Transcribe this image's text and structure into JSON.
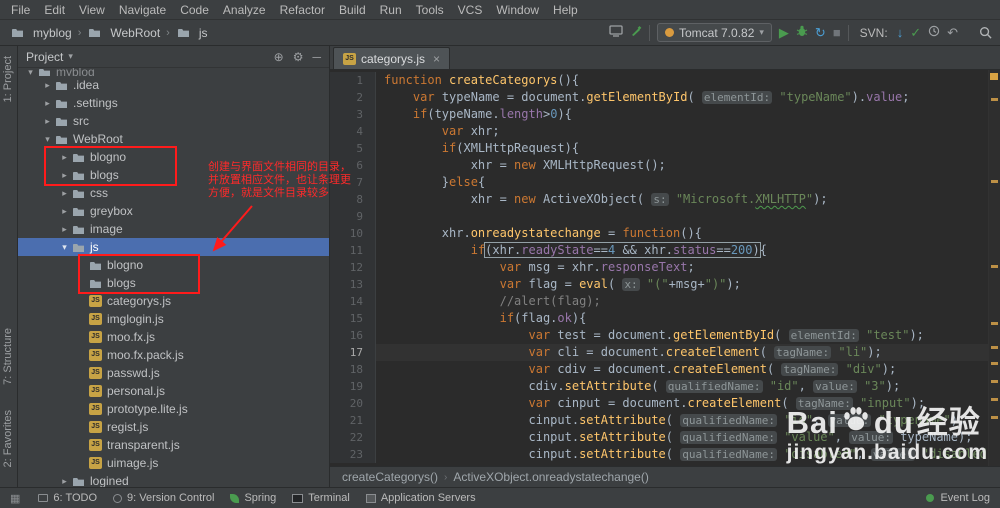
{
  "icons": {
    "chevron": "›",
    "expanded": "▾",
    "collapsed": "▸",
    "gear": "⚙",
    "target": "⊕",
    "hide": "─",
    "play": "▶",
    "stop": "■",
    "refresh": "↻",
    "check": "✓",
    "undo": "↶",
    "arrow_down": "↓",
    "caret_down": "▾",
    "close": "×",
    "corner": "▦"
  },
  "colors": {
    "selection_blue": "#4b6eaf",
    "annotation_red": "#ff1b1b",
    "keyword_orange": "#cc7832",
    "string_green": "#6a8759",
    "warning_stripe": "#bd9046"
  },
  "menubar": {
    "items": [
      "File",
      "Edit",
      "View",
      "Navigate",
      "Code",
      "Analyze",
      "Refactor",
      "Build",
      "Run",
      "Tools",
      "VCS",
      "Window",
      "Help"
    ]
  },
  "toolbar": {
    "breadcrumbs": [
      {
        "label": "myblog"
      },
      {
        "label": "WebRoot"
      },
      {
        "label": "js"
      }
    ],
    "run_config": {
      "label": "Tomcat 7.0.82"
    },
    "svn_label": "SVN:"
  },
  "project": {
    "header": {
      "title": "Project"
    },
    "tree": [
      {
        "depth": 0,
        "label": "myblog",
        "arrow": "down",
        "type": "folder",
        "partial": true
      },
      {
        "depth": 1,
        "label": ".idea",
        "arrow": "right",
        "type": "folder"
      },
      {
        "depth": 1,
        "label": ".settings",
        "arrow": "right",
        "type": "folder"
      },
      {
        "depth": 1,
        "label": "src",
        "arrow": "right",
        "type": "folder"
      },
      {
        "depth": 1,
        "label": "WebRoot",
        "arrow": "down",
        "type": "folder"
      },
      {
        "depth": 2,
        "label": "blogno",
        "arrow": "right",
        "type": "folder"
      },
      {
        "depth": 2,
        "label": "blogs",
        "arrow": "right",
        "type": "folder"
      },
      {
        "depth": 2,
        "label": "css",
        "arrow": "right",
        "type": "folder"
      },
      {
        "depth": 2,
        "label": "greybox",
        "arrow": "right",
        "type": "folder"
      },
      {
        "depth": 2,
        "label": "image",
        "arrow": "right",
        "type": "folder"
      },
      {
        "depth": 2,
        "label": "js",
        "arrow": "down",
        "type": "folder",
        "selected": true
      },
      {
        "depth": 3,
        "label": "blogno",
        "arrow": "",
        "type": "folder"
      },
      {
        "depth": 3,
        "label": "blogs",
        "arrow": "",
        "type": "folder"
      },
      {
        "depth": 3,
        "label": "categorys.js",
        "arrow": "",
        "type": "js"
      },
      {
        "depth": 3,
        "label": "imglogin.js",
        "arrow": "",
        "type": "js"
      },
      {
        "depth": 3,
        "label": "moo.fx.js",
        "arrow": "",
        "type": "js"
      },
      {
        "depth": 3,
        "label": "moo.fx.pack.js",
        "arrow": "",
        "type": "js"
      },
      {
        "depth": 3,
        "label": "passwd.js",
        "arrow": "",
        "type": "js"
      },
      {
        "depth": 3,
        "label": "personal.js",
        "arrow": "",
        "type": "js"
      },
      {
        "depth": 3,
        "label": "prototype.lite.js",
        "arrow": "",
        "type": "js"
      },
      {
        "depth": 3,
        "label": "regist.js",
        "arrow": "",
        "type": "js"
      },
      {
        "depth": 3,
        "label": "transparent.js",
        "arrow": "",
        "type": "js"
      },
      {
        "depth": 3,
        "label": "uimage.js",
        "arrow": "",
        "type": "js"
      },
      {
        "depth": 2,
        "label": "logined",
        "arrow": "right",
        "type": "folder"
      }
    ]
  },
  "annotation": {
    "lines": [
      "创建与界面文件相同的目录，",
      "并放置相应文件，也让条理更",
      "方便，就是文件目录较多"
    ]
  },
  "editor": {
    "tabs": [
      {
        "label": "categorys.js"
      }
    ],
    "breadcrumb": [
      "createCategorys()",
      "ActiveXObject.onreadystatechange()"
    ],
    "code": {
      "lines": [
        {
          "no": 1,
          "tokens": [
            [
              "k",
              "function "
            ],
            [
              "fy",
              "createCategorys"
            ],
            [
              "pl",
              "(){"
            ]
          ]
        },
        {
          "no": 2,
          "tokens": [
            [
              "pl",
              "    "
            ],
            [
              "k",
              "var"
            ],
            [
              "pl",
              " typeName = document."
            ],
            [
              "fy",
              "getElementById"
            ],
            [
              "pl",
              "( "
            ],
            [
              "h",
              "elementId:"
            ],
            [
              "pl",
              " "
            ],
            [
              "s",
              "\"typeName\""
            ],
            [
              "pl",
              ")."
            ],
            [
              "p",
              "value"
            ],
            [
              "pl",
              ";"
            ]
          ]
        },
        {
          "no": 3,
          "tokens": [
            [
              "pl",
              "    "
            ],
            [
              "k",
              "if"
            ],
            [
              "pl",
              "(typeName."
            ],
            [
              "p",
              "length"
            ],
            [
              "pl",
              ">"
            ],
            [
              "n",
              "0"
            ],
            [
              "pl",
              "){"
            ]
          ]
        },
        {
          "no": 4,
          "tokens": [
            [
              "pl",
              "        "
            ],
            [
              "k",
              "var"
            ],
            [
              "pl",
              " xhr;"
            ]
          ]
        },
        {
          "no": 5,
          "tokens": [
            [
              "pl",
              "        "
            ],
            [
              "k",
              "if"
            ],
            [
              "pl",
              "(XMLHttpRequest){"
            ]
          ]
        },
        {
          "no": 6,
          "tokens": [
            [
              "pl",
              "            xhr = "
            ],
            [
              "k",
              "new"
            ],
            [
              "pl",
              " XMLHttpRequest();"
            ]
          ]
        },
        {
          "no": 7,
          "tokens": [
            [
              "pl",
              "        }"
            ],
            [
              "k",
              "else"
            ],
            [
              "pl",
              "{"
            ]
          ]
        },
        {
          "no": 8,
          "tokens": [
            [
              "pl",
              "            xhr = "
            ],
            [
              "k",
              "new"
            ],
            [
              "pl",
              " ActiveXObject( "
            ],
            [
              "h",
              "s:"
            ],
            [
              "pl",
              " "
            ],
            [
              "s",
              "\"Microsoft."
            ],
            [
              "sw",
              "XMLHTTP"
            ],
            [
              "s",
              "\""
            ],
            [
              "pl",
              ");"
            ]
          ]
        },
        {
          "no": 9,
          "tokens": []
        },
        {
          "no": 10,
          "tokens": [
            [
              "pl",
              "        xhr."
            ],
            [
              "fy",
              "onreadystatechange"
            ],
            [
              "pl",
              " = "
            ],
            [
              "k",
              "function"
            ],
            [
              "pl",
              "(){"
            ]
          ]
        },
        {
          "no": 11,
          "tokens": [
            [
              "pl",
              "            "
            ],
            [
              "k",
              "if"
            ],
            [
              "grp",
              [
                [
                  "pl",
                  "(xhr."
                ],
                [
                  "p",
                  "readyState"
                ],
                [
                  "pl",
                  "=="
                ],
                [
                  "n",
                  "4"
                ],
                [
                  "pl",
                  " && xhr."
                ],
                [
                  "p",
                  "status"
                ],
                [
                  "pl",
                  "=="
                ],
                [
                  "n",
                  "200"
                ],
                [
                  "pl",
                  ")"
                ]
              ]
            ],
            [
              "pl",
              "{"
            ]
          ]
        },
        {
          "no": 12,
          "tokens": [
            [
              "pl",
              "                "
            ],
            [
              "k",
              "var"
            ],
            [
              "pl",
              " msg = xhr."
            ],
            [
              "p",
              "responseText"
            ],
            [
              "pl",
              ";"
            ]
          ]
        },
        {
          "no": 13,
          "tokens": [
            [
              "pl",
              "                "
            ],
            [
              "k",
              "var"
            ],
            [
              "pl",
              " flag = "
            ],
            [
              "fy",
              "eval"
            ],
            [
              "pl",
              "( "
            ],
            [
              "h",
              "x:"
            ],
            [
              "pl",
              " "
            ],
            [
              "s",
              "\"(\""
            ],
            [
              "pl",
              "+msg+"
            ],
            [
              "s",
              "\")\""
            ],
            [
              "pl",
              ");"
            ]
          ]
        },
        {
          "no": 14,
          "tokens": [
            [
              "pl",
              "                "
            ],
            [
              "c",
              "//alert(flag);"
            ]
          ]
        },
        {
          "no": 15,
          "tokens": [
            [
              "pl",
              "                "
            ],
            [
              "k",
              "if"
            ],
            [
              "pl",
              "(flag."
            ],
            [
              "p",
              "ok"
            ],
            [
              "pl",
              "){"
            ]
          ]
        },
        {
          "no": 16,
          "tokens": [
            [
              "pl",
              "                    "
            ],
            [
              "k",
              "var"
            ],
            [
              "pl",
              " test = document."
            ],
            [
              "fy",
              "getElementById"
            ],
            [
              "pl",
              "( "
            ],
            [
              "h",
              "elementId:"
            ],
            [
              "pl",
              " "
            ],
            [
              "s",
              "\"test\""
            ],
            [
              "pl",
              ");"
            ]
          ]
        },
        {
          "no": 17,
          "current": true,
          "tokens": [
            [
              "pl",
              "                    "
            ],
            [
              "k",
              "var"
            ],
            [
              "pl",
              " cli = document."
            ],
            [
              "fy",
              "createElement"
            ],
            [
              "pl",
              "( "
            ],
            [
              "h",
              "tagName:"
            ],
            [
              "pl",
              " "
            ],
            [
              "s",
              "\"li\""
            ],
            [
              "pl",
              ");"
            ]
          ]
        },
        {
          "no": 18,
          "tokens": [
            [
              "pl",
              "                    "
            ],
            [
              "k",
              "var"
            ],
            [
              "pl",
              " cdiv = document."
            ],
            [
              "fy",
              "createElement"
            ],
            [
              "pl",
              "( "
            ],
            [
              "h",
              "tagName:"
            ],
            [
              "pl",
              " "
            ],
            [
              "s",
              "\"div\""
            ],
            [
              "pl",
              ");"
            ]
          ]
        },
        {
          "no": 19,
          "tokens": [
            [
              "pl",
              "                    cdiv."
            ],
            [
              "fy",
              "setAttribute"
            ],
            [
              "pl",
              "( "
            ],
            [
              "h",
              "qualifiedName:"
            ],
            [
              "pl",
              " "
            ],
            [
              "s",
              "\"id\""
            ],
            [
              "pl",
              ", "
            ],
            [
              "h",
              "value:"
            ],
            [
              "pl",
              " "
            ],
            [
              "s",
              "\"3\""
            ],
            [
              "pl",
              ");"
            ]
          ]
        },
        {
          "no": 20,
          "tokens": [
            [
              "pl",
              "                    "
            ],
            [
              "k",
              "var"
            ],
            [
              "pl",
              " cinput = document."
            ],
            [
              "fy",
              "createElement"
            ],
            [
              "pl",
              "( "
            ],
            [
              "h",
              "tagName:"
            ],
            [
              "pl",
              " "
            ],
            [
              "s",
              "\"input\""
            ],
            [
              "pl",
              ");"
            ]
          ]
        },
        {
          "no": 21,
          "tokens": [
            [
              "pl",
              "                    cinput."
            ],
            [
              "fy",
              "setAttribute"
            ],
            [
              "pl",
              "( "
            ],
            [
              "h",
              "qualifiedName:"
            ],
            [
              "pl",
              " "
            ],
            [
              "s",
              "\"id\""
            ],
            [
              "pl",
              ", "
            ],
            [
              "h",
              "value:"
            ],
            [
              "pl",
              " "
            ],
            [
              "s",
              "\"typename\""
            ],
            [
              "pl",
              ");"
            ]
          ]
        },
        {
          "no": 22,
          "tokens": [
            [
              "pl",
              "                    cinput."
            ],
            [
              "fy",
              "setAttribute"
            ],
            [
              "pl",
              "( "
            ],
            [
              "h",
              "qualifiedName:"
            ],
            [
              "pl",
              " "
            ],
            [
              "s",
              "\"value\""
            ],
            [
              "pl",
              ", "
            ],
            [
              "h",
              "value:"
            ],
            [
              "pl",
              " typeName);"
            ]
          ]
        },
        {
          "no": 23,
          "tokens": [
            [
              "pl",
              "                    cinput."
            ],
            [
              "fy",
              "setAttribute"
            ],
            [
              "pl",
              "( "
            ],
            [
              "h",
              "qualifiedName:"
            ],
            [
              "pl",
              " "
            ],
            [
              "s",
              "\"disabled\""
            ],
            [
              "pl",
              ", "
            ],
            [
              "h",
              "value:"
            ],
            [
              "pl",
              " "
            ],
            [
              "s",
              "\"disabled\""
            ],
            [
              "pl",
              ");"
            ]
          ]
        }
      ]
    }
  },
  "statusbar": {
    "left": [
      {
        "icon": "todo",
        "label": "6: TODO"
      },
      {
        "icon": "vcs",
        "label": "9: Version Control"
      },
      {
        "icon": "spring",
        "label": "Spring"
      },
      {
        "icon": "terminal",
        "label": "Terminal"
      },
      {
        "icon": "appserver",
        "label": "Application Servers"
      }
    ],
    "right": {
      "label": "Event Log"
    }
  },
  "left_strip": {
    "items": [
      "1: Project",
      "7: Structure",
      "2: Favorites"
    ]
  },
  "watermark": {
    "brand_left": "Bai",
    "brand_right": "du",
    "brand_cn": "经验",
    "url": "jingyan.baidu.com"
  }
}
